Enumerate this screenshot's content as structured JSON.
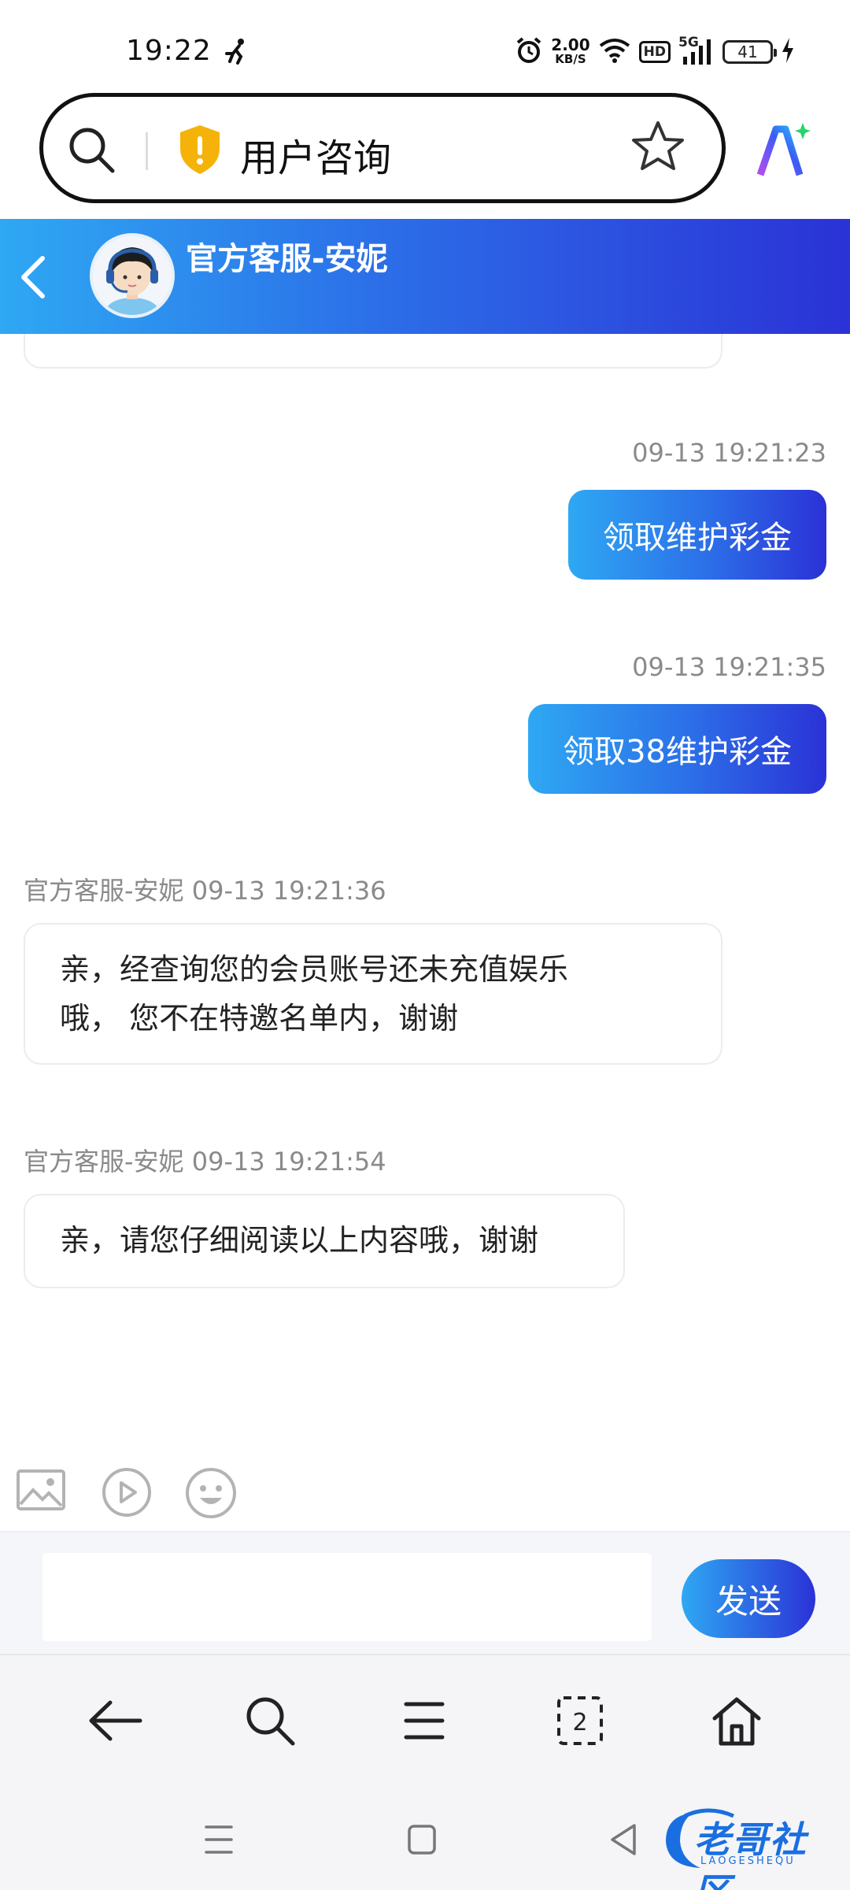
{
  "status_bar": {
    "time": "19:22",
    "net_speed_value": "2.00",
    "net_speed_unit": "KB/S",
    "hd_label": "HD",
    "network_label": "5G",
    "battery_level": "41"
  },
  "browser": {
    "page_title": "用户咨询"
  },
  "chat_header": {
    "agent_name": "官方客服-安妮"
  },
  "messages": [
    {
      "timestamp": "09-13 19:21:23",
      "text": "领取维护彩金"
    },
    {
      "timestamp": "09-13 19:21:35",
      "text": "领取38维护彩金"
    },
    {
      "sender": "官方客服-安妮",
      "timestamp": "09-13 19:21:36",
      "line1": "亲，经查询您的会员账号还未充值娱乐",
      "line2": "哦， 您不在特邀名单内，谢谢"
    },
    {
      "sender": "官方客服-安妮",
      "timestamp": "09-13 19:21:54",
      "text": "亲，请您仔细阅读以上内容哦，谢谢"
    }
  ],
  "composer": {
    "input_value": "",
    "send_label": "发送"
  },
  "browser_nav": {
    "tab_count": "2"
  },
  "watermark": {
    "text": "老哥社区",
    "sub": "LAOGESHEQU"
  },
  "colors": {
    "accent_start": "#2ea8f3",
    "accent_end": "#2b32d6",
    "shield": "#f5b30a"
  }
}
